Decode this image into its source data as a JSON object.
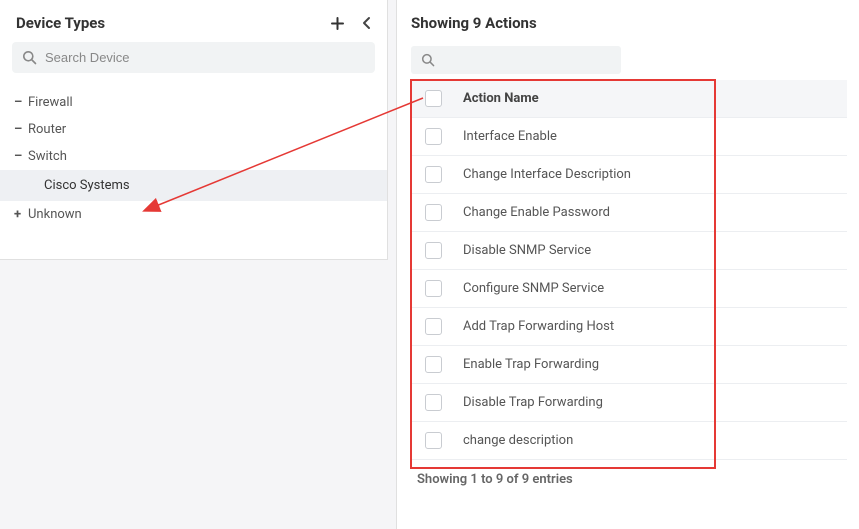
{
  "sidebar": {
    "title": "Device Types",
    "search_placeholder": "Search Device",
    "items": [
      {
        "label": "Firewall",
        "expander": "–"
      },
      {
        "label": "Router",
        "expander": "–"
      },
      {
        "label": "Switch",
        "expander": "–"
      },
      {
        "label": "Unknown",
        "expander": "+"
      }
    ],
    "sub_item_label": "Cisco Systems"
  },
  "main": {
    "title": "Showing 9 Actions",
    "header_col": "Action Name",
    "rows": [
      {
        "name": "Interface Enable"
      },
      {
        "name": "Change Interface Description"
      },
      {
        "name": "Change Enable Password"
      },
      {
        "name": "Disable SNMP Service"
      },
      {
        "name": "Configure SNMP Service"
      },
      {
        "name": "Add Trap Forwarding Host"
      },
      {
        "name": "Enable Trap Forwarding"
      },
      {
        "name": "Disable Trap Forwarding"
      },
      {
        "name": "change description"
      }
    ],
    "footer": "Showing 1 to 9 of 9 entries"
  }
}
